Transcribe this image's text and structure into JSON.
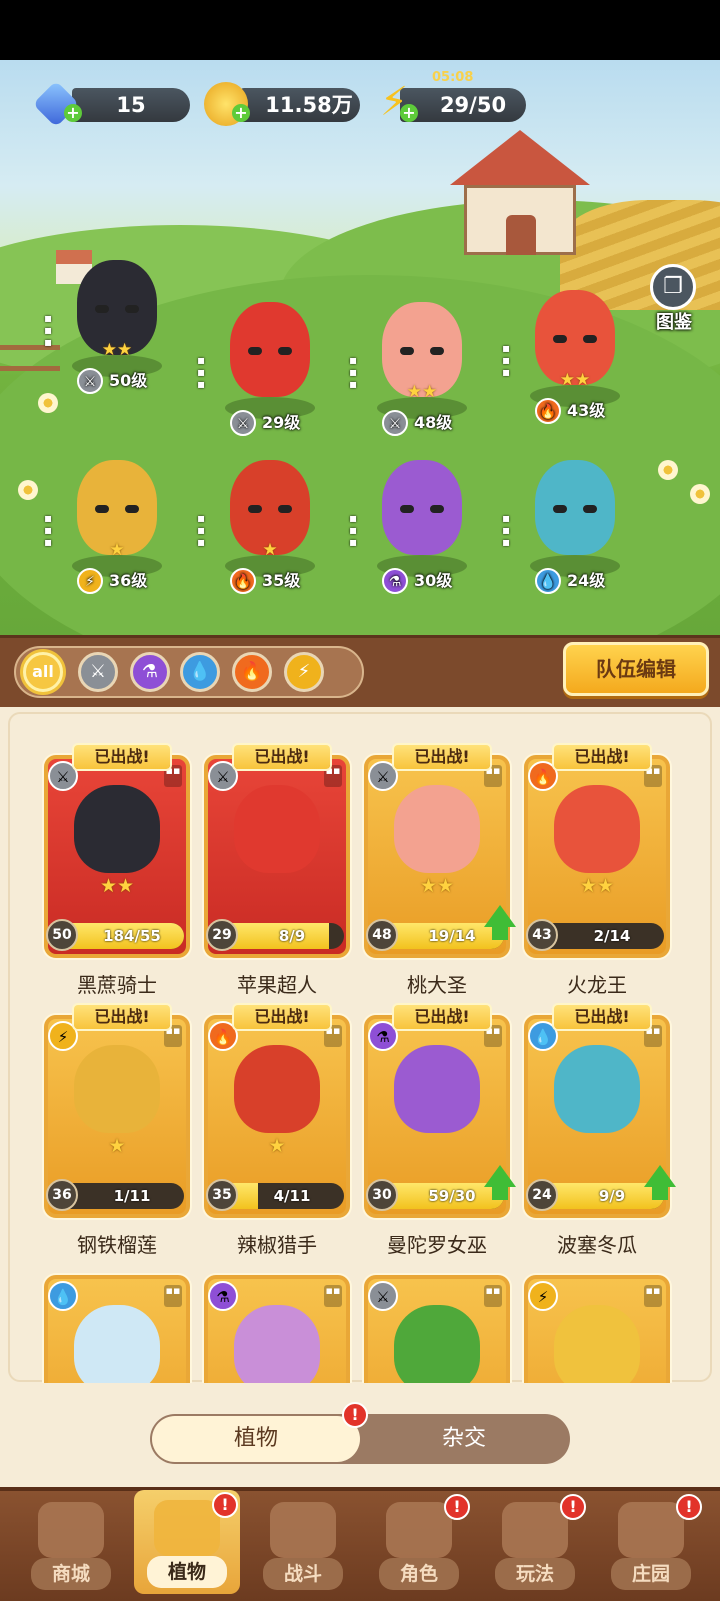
{
  "resources": {
    "gems": "15",
    "gold": "11.58万",
    "energy": "29/50",
    "timer": "05:08"
  },
  "atlas_label": "图鉴",
  "team_edit_label": "队伍编辑",
  "filters": [
    "all",
    "sword",
    "potion",
    "water",
    "fire",
    "lightning"
  ],
  "lineup": [
    {
      "level": "50级",
      "element": "sword",
      "stars": 2,
      "color": "#2b2b33"
    },
    {
      "level": "29级",
      "element": "sword",
      "stars": 0,
      "color": "#e0392f"
    },
    {
      "level": "48级",
      "element": "sword",
      "stars": 2,
      "color": "#f3a290"
    },
    {
      "level": "43级",
      "element": "fire",
      "stars": 2,
      "color": "#e8533b"
    },
    {
      "level": "36级",
      "element": "lightning",
      "stars": 1,
      "color": "#e8b33a"
    },
    {
      "level": "35级",
      "element": "fire",
      "stars": 1,
      "color": "#d8402a"
    },
    {
      "level": "30级",
      "element": "potion",
      "stars": 0,
      "color": "#9b5bd1"
    },
    {
      "level": "24级",
      "element": "water",
      "stars": 0,
      "color": "#4fb6c8"
    }
  ],
  "cards": [
    {
      "name": "黑蔗骑士",
      "level": "50",
      "progress": "184/55",
      "fill": 1.0,
      "deployed": "已出战!",
      "element": "sword",
      "stars": 2,
      "frame": "red",
      "color": "#2b2b33",
      "upgrade": false
    },
    {
      "name": "苹果超人",
      "level": "29",
      "progress": "8/9",
      "fill": 0.89,
      "deployed": "已出战!",
      "element": "sword",
      "stars": 0,
      "frame": "red",
      "color": "#e0392f",
      "upgrade": false
    },
    {
      "name": "桃大圣",
      "level": "48",
      "progress": "19/14",
      "fill": 1.0,
      "deployed": "已出战!",
      "element": "sword",
      "stars": 2,
      "frame": "gold",
      "color": "#f3a290",
      "upgrade": true
    },
    {
      "name": "火龙王",
      "level": "43",
      "progress": "2/14",
      "fill": 0.14,
      "deployed": "已出战!",
      "element": "fire",
      "stars": 2,
      "frame": "gold",
      "color": "#e8533b",
      "upgrade": false
    },
    {
      "name": "钢铁榴莲",
      "level": "36",
      "progress": "1/11",
      "fill": 0.09,
      "deployed": "已出战!",
      "element": "lightning",
      "stars": 1,
      "frame": "gold",
      "color": "#e8b33a",
      "upgrade": false
    },
    {
      "name": "辣椒猎手",
      "level": "35",
      "progress": "4/11",
      "fill": 0.36,
      "deployed": "已出战!",
      "element": "fire",
      "stars": 1,
      "frame": "gold",
      "color": "#d8402a",
      "upgrade": false
    },
    {
      "name": "曼陀罗女巫",
      "level": "30",
      "progress": "59/30",
      "fill": 1.0,
      "deployed": "已出战!",
      "element": "potion",
      "stars": 0,
      "frame": "gold",
      "color": "#9b5bd1",
      "upgrade": true
    },
    {
      "name": "波塞冬瓜",
      "level": "24",
      "progress": "9/9",
      "fill": 1.0,
      "deployed": "已出战!",
      "element": "water",
      "stars": 0,
      "frame": "gold",
      "color": "#4fb6c8",
      "upgrade": true
    },
    {
      "element": "water",
      "frame": "gold",
      "color": "#cfe8f5"
    },
    {
      "element": "potion",
      "frame": "gold",
      "color": "#c98fd8"
    },
    {
      "element": "sword",
      "frame": "gold",
      "color": "#4fa83a"
    },
    {
      "element": "lightning",
      "frame": "gold",
      "color": "#f0c23d"
    }
  ],
  "tabs": {
    "plants": "植物",
    "hybrid": "杂交",
    "alert": "!"
  },
  "nav": [
    {
      "label": "商城",
      "active": false,
      "alert": false
    },
    {
      "label": "植物",
      "active": true,
      "alert": true
    },
    {
      "label": "战斗",
      "active": false,
      "alert": false
    },
    {
      "label": "角色",
      "active": false,
      "alert": true
    },
    {
      "label": "玩法",
      "active": false,
      "alert": true
    },
    {
      "label": "庄园",
      "active": false,
      "alert": true
    }
  ],
  "colors": {
    "sword": "#8a8f96",
    "fire": "#f06a1e",
    "water": "#3d9be0",
    "potion": "#8e4fd6",
    "lightning": "#f0b21c"
  }
}
